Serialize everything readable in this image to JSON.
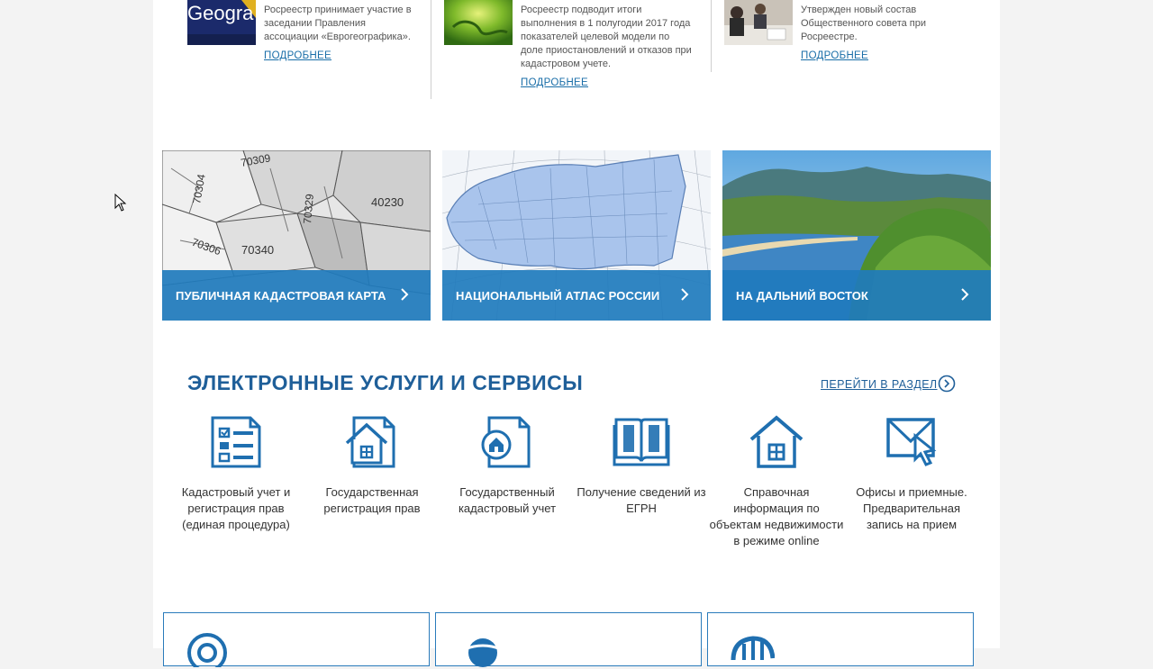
{
  "news": [
    {
      "text_lines": [
        "Росреестр принимает участие в",
        "заседании Правления",
        "ассоциации «Еврогеографика»."
      ],
      "thumb_text": "Geogra",
      "more_label": "ПОДРОБНЕЕ"
    },
    {
      "text_lines": [
        "Росреестр подводит итоги",
        "выполнения в 1 полугодии 2017 года",
        "показателей целевой модели по",
        "доле приостановлений и отказов при",
        "кадастровом учете."
      ],
      "more_label": "ПОДРОБНЕЕ"
    },
    {
      "text_lines": [
        "Утвержден новый состав",
        "Общественного совета при",
        "Росреестре."
      ],
      "more_label": "ПОДРОБНЕЕ"
    }
  ],
  "cards": [
    {
      "label": "ПУБЛИЧНАЯ КАДАСТРОВАЯ КАРТА",
      "map_numbers": [
        "70309",
        "70304",
        "70329",
        "40230",
        "70306",
        "70340"
      ]
    },
    {
      "label": "НАЦИОНАЛЬНЫЙ АТЛАС РОССИИ"
    },
    {
      "label": "НА ДАЛЬНИЙ ВОСТОК"
    }
  ],
  "services_section": {
    "title": "ЭЛЕКТРОННЫЕ УСЛУГИ И СЕРВИСЫ",
    "go_label": "ПЕРЕЙТИ В РАЗДЕЛ",
    "items": [
      {
        "label": "Кадастровый учет и регистрация прав (единая процедура)",
        "icon": "checklist-document-icon"
      },
      {
        "label": "Государственная регистрация прав",
        "icon": "house-document-icon"
      },
      {
        "label": "Государственный кадастровый учет",
        "icon": "house-circle-document-icon"
      },
      {
        "label": "Получение сведений из ЕГРН",
        "icon": "open-book-icon"
      },
      {
        "label": "Справочная информация по объектам недвижимости в режиме online",
        "icon": "house-icon"
      },
      {
        "label": "Офисы и приемные. Предварительная запись на прием",
        "icon": "envelope-cursor-icon"
      }
    ]
  },
  "colors": {
    "accent": "#1f7bbd",
    "title": "#1f5f99",
    "link": "#1a6ea8"
  }
}
